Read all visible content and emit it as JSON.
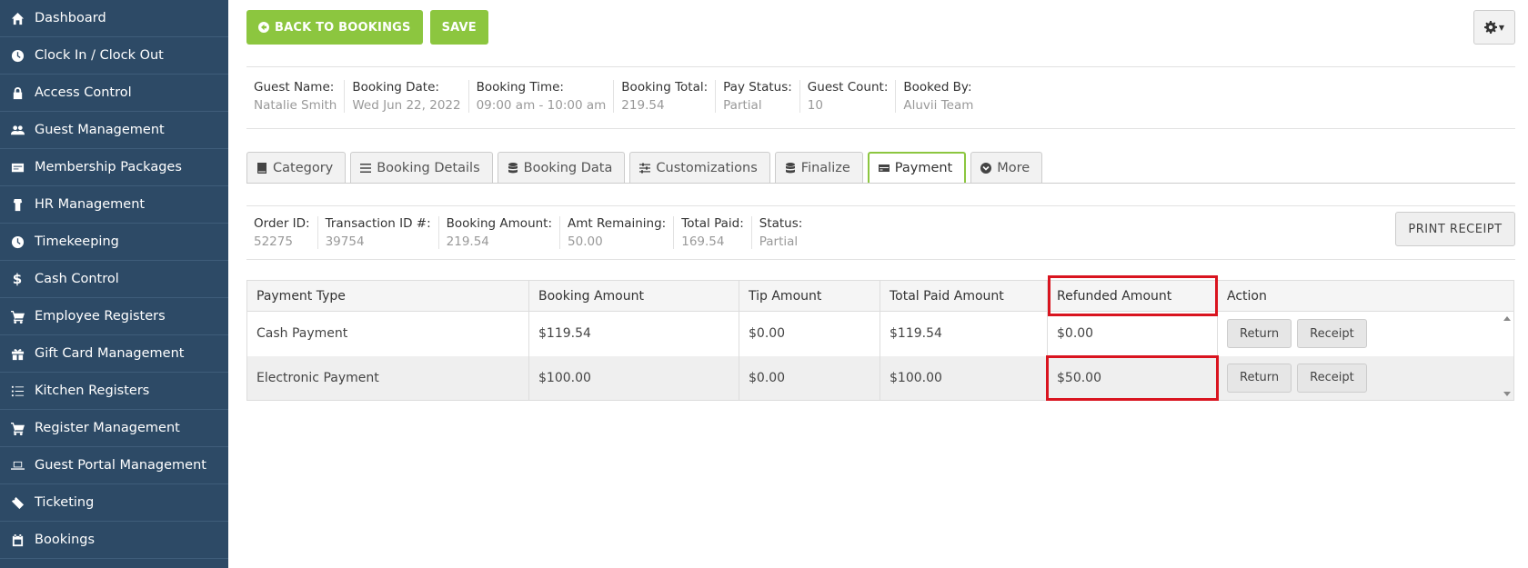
{
  "sidebar": {
    "items": [
      {
        "label": "Dashboard",
        "icon": "home-icon"
      },
      {
        "label": "Clock In / Clock Out",
        "icon": "clock-icon"
      },
      {
        "label": "Access Control",
        "icon": "lock-icon"
      },
      {
        "label": "Guest Management",
        "icon": "users-icon"
      },
      {
        "label": "Membership Packages",
        "icon": "id-card-icon"
      },
      {
        "label": "HR Management",
        "icon": "user-tie-icon"
      },
      {
        "label": "Timekeeping",
        "icon": "clock-icon"
      },
      {
        "label": "Cash Control",
        "icon": "dollar-icon"
      },
      {
        "label": "Employee Registers",
        "icon": "cart-icon"
      },
      {
        "label": "Gift Card Management",
        "icon": "gift-icon"
      },
      {
        "label": "Kitchen Registers",
        "icon": "list-icon"
      },
      {
        "label": "Register Management",
        "icon": "cart-icon"
      },
      {
        "label": "Guest Portal Management",
        "icon": "laptop-icon"
      },
      {
        "label": "Ticketing",
        "icon": "ticket-icon"
      },
      {
        "label": "Bookings",
        "icon": "calendar-icon"
      }
    ]
  },
  "toolbar": {
    "back_label": "BACK TO BOOKINGS",
    "save_label": "SAVE"
  },
  "booking_info": [
    {
      "label": "Guest Name:",
      "value": "Natalie Smith"
    },
    {
      "label": "Booking Date:",
      "value": "Wed Jun 22, 2022"
    },
    {
      "label": "Booking Time:",
      "value": "09:00 am - 10:00 am"
    },
    {
      "label": "Booking Total:",
      "value": "219.54"
    },
    {
      "label": "Pay Status:",
      "value": "Partial"
    },
    {
      "label": "Guest Count:",
      "value": "10"
    },
    {
      "label": "Booked By:",
      "value": "Aluvii Team"
    }
  ],
  "tabs": [
    {
      "label": "Category",
      "icon": "book-icon"
    },
    {
      "label": "Booking Details",
      "icon": "list-icon"
    },
    {
      "label": "Booking Data",
      "icon": "database-icon"
    },
    {
      "label": "Customizations",
      "icon": "sliders-icon"
    },
    {
      "label": "Finalize",
      "icon": "database-icon"
    },
    {
      "label": "Payment",
      "icon": "credit-card-icon",
      "active": true
    },
    {
      "label": "More",
      "icon": "chevron-circle-icon"
    }
  ],
  "order_info": [
    {
      "label": "Order ID:",
      "value": "52275"
    },
    {
      "label": "Transaction ID #:",
      "value": "39754"
    },
    {
      "label": "Booking Amount:",
      "value": "219.54"
    },
    {
      "label": "Amt Remaining:",
      "value": "50.00"
    },
    {
      "label": "Total Paid:",
      "value": "169.54"
    },
    {
      "label": "Status:",
      "value": "Partial"
    }
  ],
  "print_receipt_label": "PRINT RECEIPT",
  "payments": {
    "headers": [
      "Payment Type",
      "Booking Amount",
      "Tip Amount",
      "Total Paid Amount",
      "Refunded Amount",
      "Action"
    ],
    "rows": [
      {
        "type": "Cash Payment",
        "booking": "$119.54",
        "tip": "$0.00",
        "total": "$119.54",
        "refunded": "$0.00"
      },
      {
        "type": "Electronic Payment",
        "booking": "$100.00",
        "tip": "$0.00",
        "total": "$100.00",
        "refunded": "$50.00"
      }
    ],
    "return_label": "Return",
    "receipt_label": "Receipt"
  },
  "colors": {
    "sidebar": "#2d4a66",
    "accent": "#8cc63f",
    "highlight": "#d9141f"
  }
}
